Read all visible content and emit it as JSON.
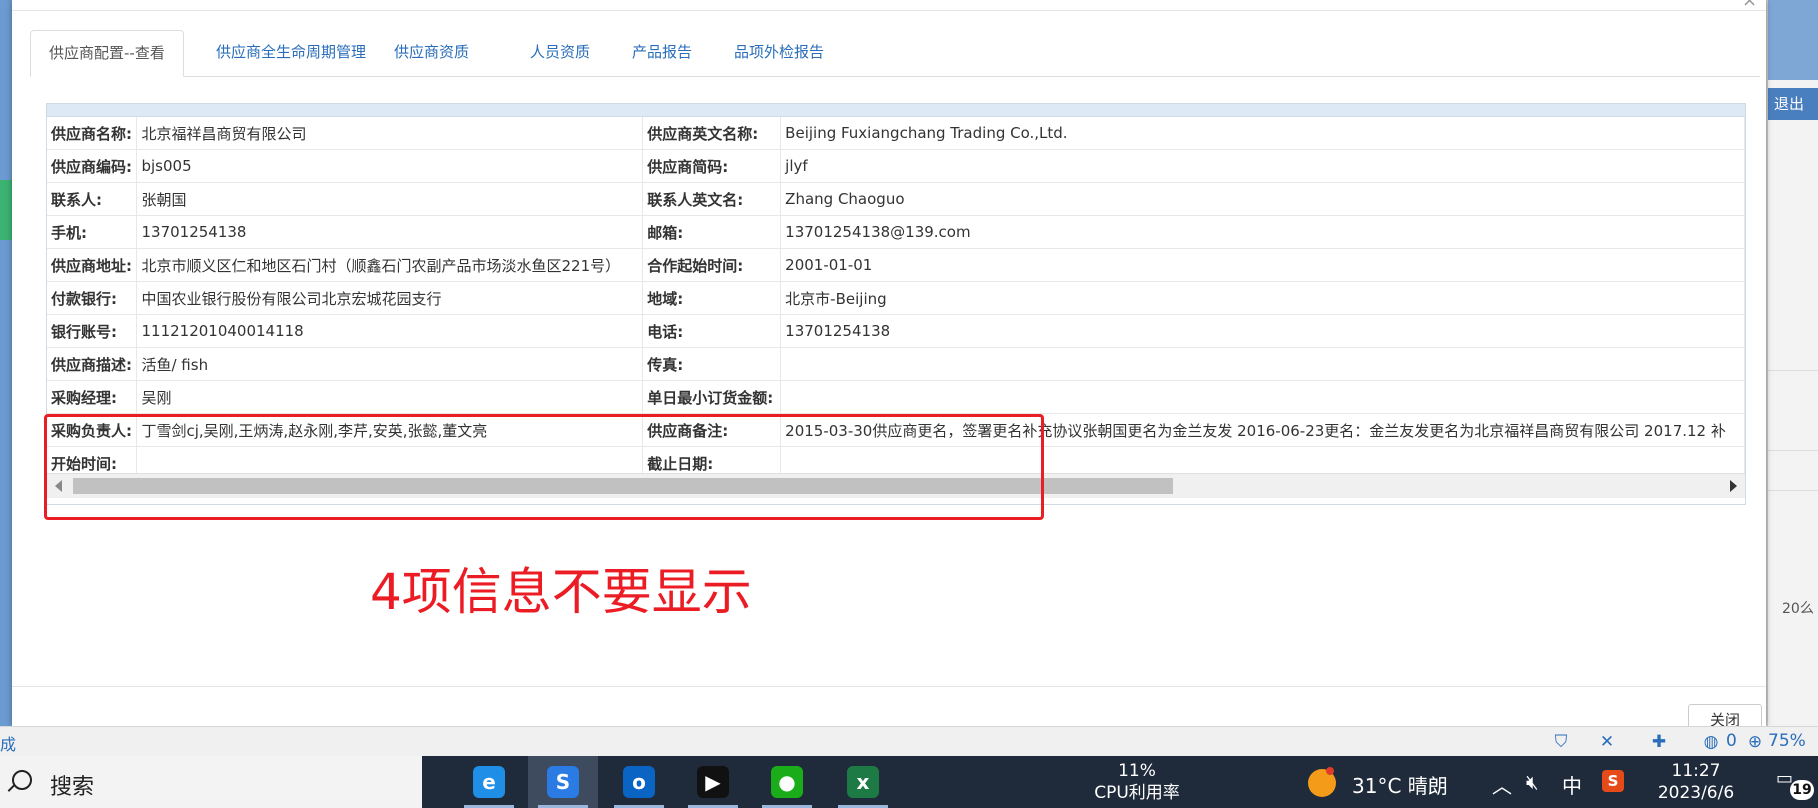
{
  "modal": {
    "tabs": [
      {
        "label": "供应商配置--查看",
        "active": true
      },
      {
        "label": "供应商全生命周期管理"
      },
      {
        "label": "供应商资质"
      },
      {
        "label": "人员资质"
      },
      {
        "label": "产品报告"
      },
      {
        "label": "品项外检报告"
      }
    ],
    "info": {
      "rows": [
        {
          "l1": "供应商名称:",
          "v1": "北京福祥昌商贸有限公司",
          "l2": "供应商英文名称:",
          "v2": "Beijing Fuxiangchang Trading Co.,Ltd."
        },
        {
          "l1": "供应商编码:",
          "v1": "bjs005",
          "l2": "供应商简码:",
          "v2": "jlyf"
        },
        {
          "l1": "联系人:",
          "v1": "张朝国",
          "l2": "联系人英文名:",
          "v2": "Zhang Chaoguo"
        },
        {
          "l1": "手机:",
          "v1": "13701254138",
          "l2": "邮箱:",
          "v2": "13701254138@139.com"
        },
        {
          "l1": "供应商地址:",
          "v1": "北京市顺义区仁和地区石门村（顺鑫石门农副产品市场淡水鱼区221号）",
          "l2": "合作起始时间:",
          "v2": "2001-01-01"
        },
        {
          "l1": "付款银行:",
          "v1": "中国农业银行股份有限公司北京宏城花园支行",
          "l2": "地域:",
          "v2": "北京市-Beijing"
        },
        {
          "l1": "银行账号:",
          "v1": "11121201040014118",
          "l2": "电话:",
          "v2": "13701254138"
        },
        {
          "l1": "供应商描述:",
          "v1": "活鱼/ fish",
          "l2": "传真:",
          "v2": ""
        },
        {
          "l1": "采购经理:",
          "v1": "吴刚",
          "l2": "单日最小订货金额:",
          "v2": ""
        },
        {
          "l1": "采购负责人:",
          "v1": "丁雪剑cj,吴刚,王炳涛,赵永刚,李芹,安英,张懿,董文亮",
          "l2": "供应商备注:",
          "v2": "2015-03-30供应商更名，签署更名补充协议张朝国更名为金兰友发 2016-06-23更名：金兰友发更名为北京福祥昌商贸有限公司 2017.12 补"
        },
        {
          "l1": "开始时间:",
          "v1": "",
          "l2": "截止日期:",
          "v2": ""
        }
      ]
    },
    "annotation": "4项信息不要显示",
    "close_label": "关闭"
  },
  "background": {
    "right_logout": "退出",
    "right_number": "20么"
  },
  "statusbar": {
    "left_text": "成",
    "count": "0",
    "zoom": "75%"
  },
  "taskbar": {
    "search_label": "搜索",
    "apps": [
      {
        "name": "ie-icon",
        "glyph": "e",
        "color": "#1e8ee6"
      },
      {
        "name": "sogou-browser-icon",
        "glyph": "S",
        "color": "#2a7be4",
        "active": true
      },
      {
        "name": "outlook-icon",
        "glyph": "o",
        "color": "#0a64c4"
      },
      {
        "name": "app-red-icon",
        "glyph": "▶",
        "color": "#111111"
      },
      {
        "name": "wechat-icon",
        "glyph": "●",
        "color": "#1aad19"
      },
      {
        "name": "excel-icon",
        "glyph": "x",
        "color": "#1e7a45"
      }
    ],
    "cpu_percent": "11%",
    "cpu_label": "CPU利用率",
    "weather": "31°C  晴朗",
    "ime": "中",
    "time": "11:27",
    "date": "2023/6/6",
    "notifications": "19"
  },
  "colors": {
    "accent": "#2a6ebb",
    "annotation": "#ec1c24"
  }
}
